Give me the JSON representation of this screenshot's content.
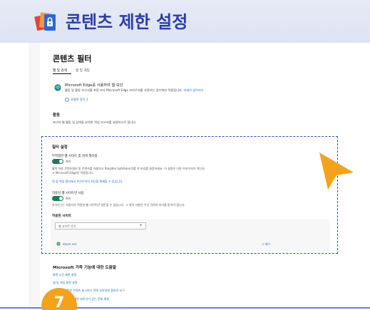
{
  "banner": {
    "title": "콘텐츠 제한 설정",
    "icon": "lock-documents-icon"
  },
  "page": {
    "title": "콘텐츠 필터",
    "tabs": [
      {
        "label": "웹 및 검색",
        "selected": true
      },
      {
        "label": "앱 및 게임",
        "selected": false
      }
    ],
    "edge_card": {
      "title": "Microsoft Edge를 사용하여 웹 보안",
      "description": "활동 및 활동 보고서를 포함 보다 Microsoft Edge 브라우저를 사용하는 경우에만 적용됩니다.",
      "description_link": "자세히 알아보기",
      "connected": "연결된 장치 3"
    },
    "activity": {
      "heading": "활동",
      "description": "자녀의 웹 활동 및 검색을 요약한 작업 보고서를 설정하시기 합니다."
    },
    "filter_settings": {
      "heading": "필터 설정",
      "inappropriate": {
        "label": "부적절한 웹 사이트 및 검색 필터링",
        "toggle_label": "켜기",
        "toggle_on": true,
        "desc_line1": "활짝 허용 콘텐츠필터 및 콘텐츠를 허용하고 Bing에서 SafeSearch를 켜 보호를 설정하세요. 이 설정은 다른 브라우저가 차단되",
        "desc_line2": "고 Microsoft Edge만 적용됩니다.",
        "link": "앱 및 게임 필터에서 브라우저의 차단을 해제할 수 있습니다."
      },
      "allowed_only": {
        "label": "허용된 웹 사이트만 사용",
        "toggle_label": "켜기",
        "toggle_on": true,
        "desc": "자녀(는)는 사용자가 허용한 웹 사이트만 방문할 수 있습니다. 그 외의 사항은 우선 귀하의 허가를 받아야 합니다."
      },
      "allowed_sites": {
        "heading": "허용된 사이트",
        "input_placeholder": "웹 사이트 추가",
        "add_symbol": "+",
        "sites": [
          {
            "name": "daum.net",
            "remove_label": "× 제거"
          }
        ]
      }
    },
    "help": {
      "heading": "Microsoft 가족 기능에 대한 도움말",
      "links": [
        "화면 시간 제한 설정",
        "앱 및 게임 제한 설정",
        "자녀가 부적절한 콘텐츠 표시하기 전에 부호하게 필요로 요구",
        "웹 사이트 검색에 대한 바로가기 있는 문제 해결"
      ]
    }
  },
  "step": {
    "number": "7"
  },
  "colors": {
    "banner_title": "#2b3ea8",
    "accent_orange": "#f5a21b",
    "toggle_on": "#1d7a5e",
    "link": "#2a6bcf",
    "dashed_border": "#2b4fb5"
  }
}
